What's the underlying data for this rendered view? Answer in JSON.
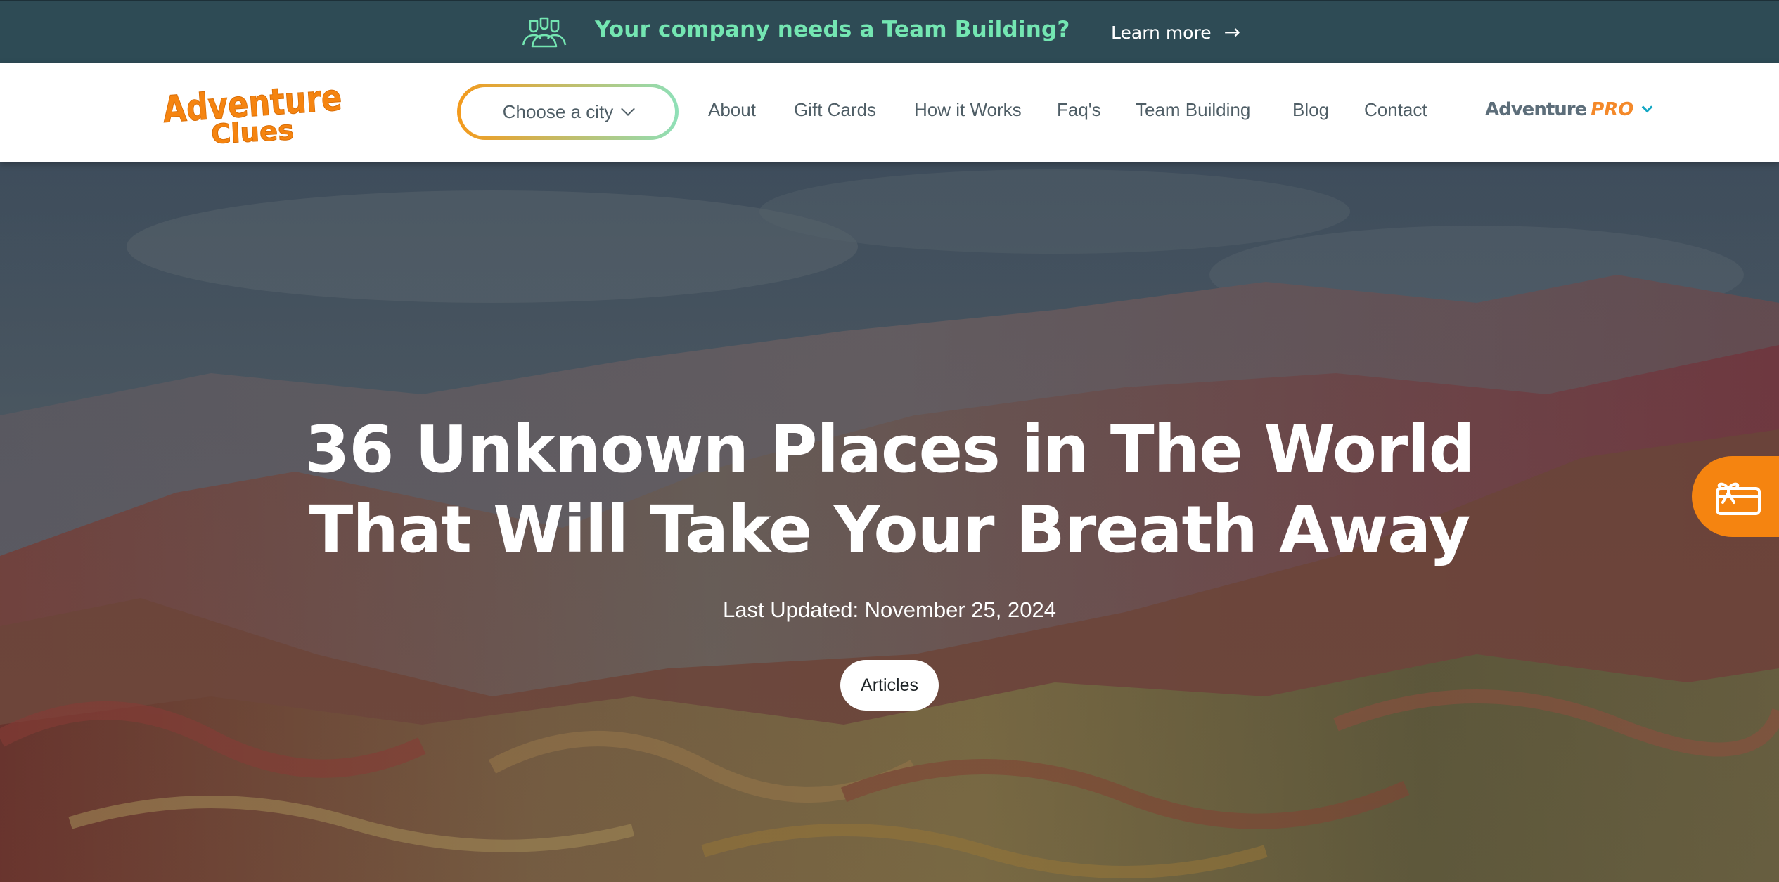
{
  "promo": {
    "text": "Your company needs a Team Building?",
    "link_label": "Learn more",
    "link_arrow": "→",
    "icon": "team-icon"
  },
  "logo": {
    "line1": "Adventure",
    "line2": "Clues"
  },
  "nav": {
    "city_button": "Choose a city",
    "items": [
      "About",
      "Gift Cards",
      "How it Works",
      "Faq's",
      "Team Building",
      "Blog",
      "Contact"
    ],
    "pro_label_a": "Adventure",
    "pro_label_b": "PRO"
  },
  "hero": {
    "title_line1": "36 Unknown Places in The World",
    "title_line2": "That Will Take Your Breath Away",
    "date": "Last Updated: November 25, 2024",
    "tag": "Articles"
  },
  "gift_button": {
    "icon": "gift-card-icon"
  },
  "colors": {
    "banner_bg": "#2e4b55",
    "banner_text": "#74e6b2",
    "brand_orange": "#f58410",
    "nav_text": "#4f5e66",
    "pro_chevron": "#12a7c4"
  }
}
